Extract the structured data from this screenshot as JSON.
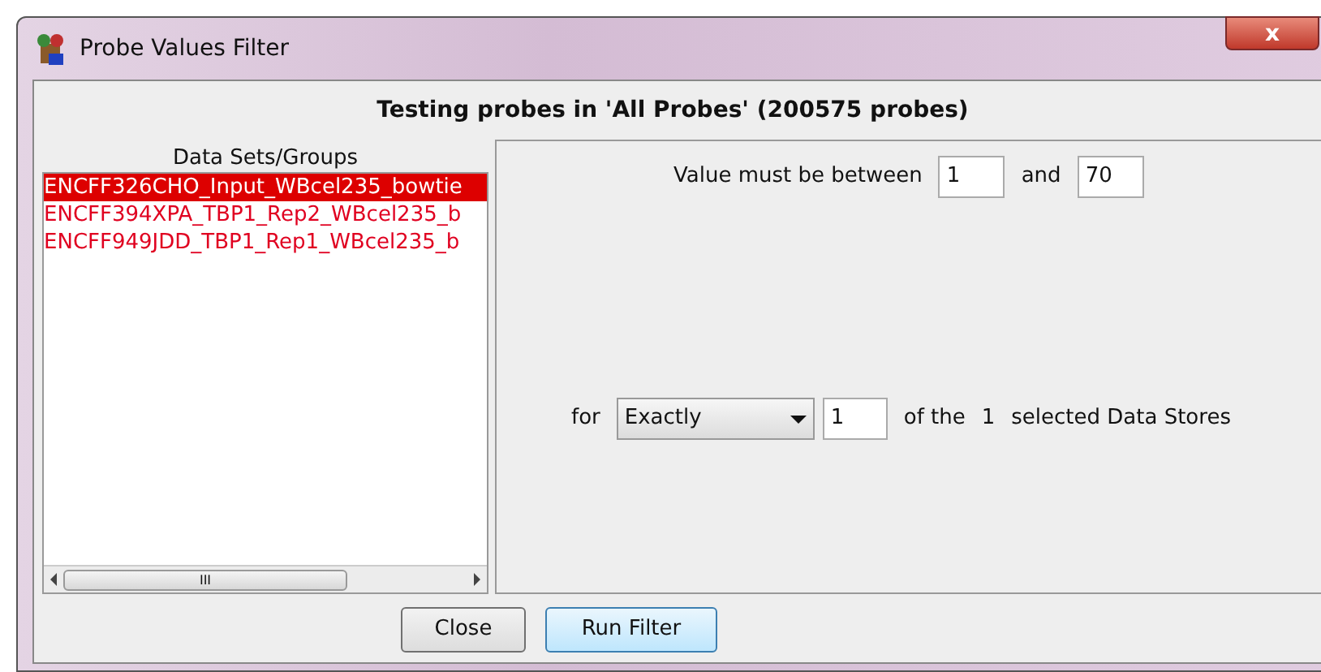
{
  "window": {
    "title": "Probe Values Filter",
    "close": "x"
  },
  "heading": "Testing probes in 'All Probes' (200575 probes)",
  "datasets": {
    "label": "Data Sets/Groups",
    "items": [
      {
        "name": "ENCFF326CHO_Input_WBcel235_bowtie",
        "selected": true
      },
      {
        "name": "ENCFF394XPA_TBP1_Rep2_WBcel235_b",
        "selected": false
      },
      {
        "name": "ENCFF949JDD_TBP1_Rep1_WBcel235_b",
        "selected": false
      }
    ],
    "scroll_grip": "III"
  },
  "range": {
    "label": "Value must be between",
    "min": "1",
    "and": "and",
    "max": "70"
  },
  "count": {
    "for": "for",
    "mode": "Exactly",
    "number": "1",
    "of_the": "of the",
    "total": "1",
    "suffix": "selected Data Stores"
  },
  "buttons": [
    {
      "label": "Close",
      "kind": "normal"
    },
    {
      "label": "Run Filter",
      "kind": "default"
    }
  ]
}
